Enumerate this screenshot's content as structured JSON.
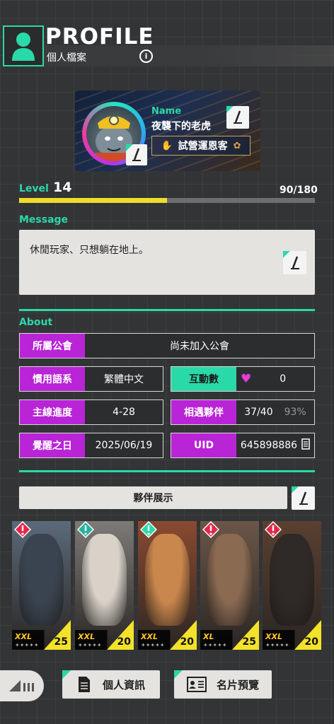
{
  "header": {
    "title": "PROFILE",
    "subtitle": "個人檔案",
    "info_glyph": "i"
  },
  "card": {
    "name_label": "Name",
    "name": "夜襲下的老虎",
    "title_badge": "試營運恩客"
  },
  "level": {
    "label": "Level",
    "value": "14",
    "progress_text": "90/180",
    "progress_fraction": 0.5
  },
  "message": {
    "label": "Message",
    "text": "休閒玩家、只想躺在地上。"
  },
  "about": {
    "label": "About",
    "guild": {
      "key": "所屬公會",
      "value": "尚未加入公會"
    },
    "language": {
      "key": "慣用語系",
      "value": "繁體中文"
    },
    "interactions": {
      "key": "互動數",
      "value": "0"
    },
    "progress": {
      "key": "主線進度",
      "value": "4-28"
    },
    "partners": {
      "key": "相遇夥伴",
      "value": "37/40",
      "percent": "93%"
    },
    "awaken": {
      "key": "覺醒之日",
      "value": "2025/06/19"
    },
    "uid": {
      "key": "UID",
      "value": "645898886"
    }
  },
  "partner_showcase": {
    "label": "夥伴展示",
    "cards": [
      {
        "size": "XXL",
        "level": "25",
        "badge_color": "#e4264a",
        "bg": "#5b6a7a",
        "fur": "#3a4450"
      },
      {
        "size": "XXL",
        "level": "20",
        "badge_color": "#23b39a",
        "bg": "#7d7a78",
        "fur": "#d9d2c8"
      },
      {
        "size": "XXL",
        "level": "20",
        "badge_color": "#2ad9a8",
        "bg": "#8a4a30",
        "fur": "#c9874e"
      },
      {
        "size": "XL",
        "level": "25",
        "badge_color": "#e4264a",
        "bg": "#6b5648",
        "fur": "#8b6a52"
      },
      {
        "size": "XXL",
        "level": "20",
        "badge_color": "#e4264a",
        "bg": "#5a4030",
        "fur": "#2f2a28"
      }
    ]
  },
  "bottom": {
    "personal_info": "個人資訊",
    "card_preview": "名片預覽"
  },
  "colors": {
    "accent": "#2ad9a8",
    "purple": "#b824d6",
    "level_bar": "#f0dc2c"
  }
}
